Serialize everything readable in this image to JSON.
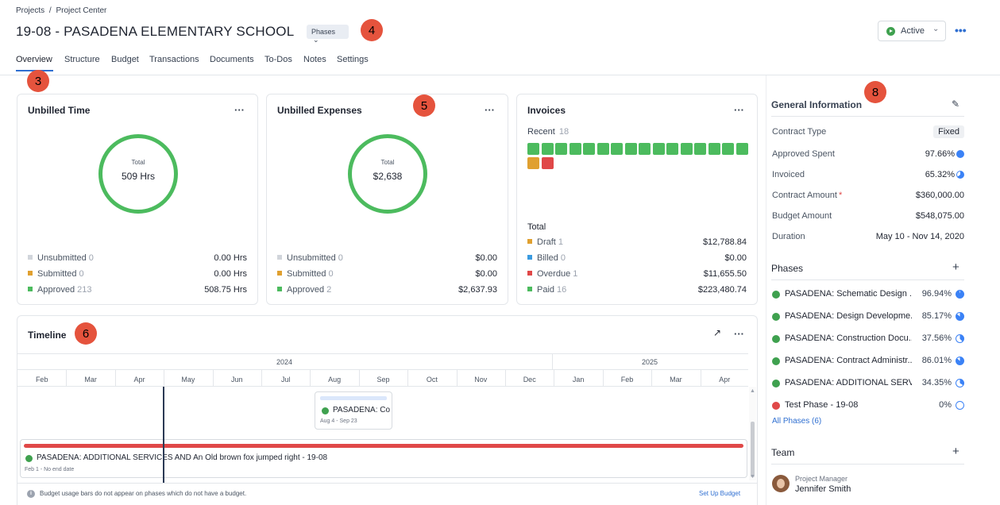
{
  "breadcrumb": {
    "projects": "Projects",
    "sep": "/",
    "current": "Project Center"
  },
  "project": {
    "title": "19-08 - PASADENA ELEMENTARY SCHOOL",
    "phases_btn": "Phases"
  },
  "status": {
    "label": "Active"
  },
  "tabs": [
    "Overview",
    "Structure",
    "Budget",
    "Transactions",
    "Documents",
    "To-Dos",
    "Notes",
    "Settings"
  ],
  "annotations": [
    "4",
    "3",
    "5",
    "6",
    "8"
  ],
  "unbilled_time": {
    "title": "Unbilled Time",
    "total_label": "Total",
    "total_value": "509 Hrs",
    "rows": [
      {
        "label": "Unsubmitted",
        "count": "0",
        "value": "0.00 Hrs",
        "color": "#d1d5db"
      },
      {
        "label": "Submitted",
        "count": "0",
        "value": "0.00 Hrs",
        "color": "#e0a030"
      },
      {
        "label": "Approved",
        "count": "213",
        "value": "508.75 Hrs",
        "color": "#4cbb5e"
      }
    ]
  },
  "unbilled_expenses": {
    "title": "Unbilled Expenses",
    "total_label": "Total",
    "total_value": "$2,638",
    "rows": [
      {
        "label": "Unsubmitted",
        "count": "0",
        "value": "$0.00",
        "color": "#d1d5db"
      },
      {
        "label": "Submitted",
        "count": "0",
        "value": "$0.00",
        "color": "#e0a030"
      },
      {
        "label": "Approved",
        "count": "2",
        "value": "$2,637.93",
        "color": "#4cbb5e"
      }
    ]
  },
  "invoices": {
    "title": "Invoices",
    "recent_label": "Recent",
    "recent_count": "18",
    "total_label": "Total",
    "green_count": 16,
    "rows": [
      {
        "label": "Draft",
        "count": "1",
        "value": "$12,788.84",
        "color": "#e0a030"
      },
      {
        "label": "Billed",
        "count": "0",
        "value": "$0.00",
        "color": "#3b9be0"
      },
      {
        "label": "Overdue",
        "count": "1",
        "value": "$11,655.50",
        "color": "#e04848"
      },
      {
        "label": "Paid",
        "count": "16",
        "value": "$223,480.74",
        "color": "#4cbb5e"
      }
    ]
  },
  "timeline": {
    "title": "Timeline",
    "years": [
      "2024",
      "2025"
    ],
    "months": [
      "Feb",
      "Mar",
      "Apr",
      "May",
      "Jun",
      "Jul",
      "Aug",
      "Sep",
      "Oct",
      "Nov",
      "Dec",
      "Jan",
      "Feb",
      "Mar",
      "Apr"
    ],
    "phase_card": {
      "name": "PASADENA: Co",
      "dates": "Aug 4 - Sep 23"
    },
    "bar": {
      "name": "PASADENA: ADDITIONAL SERVICES AND An Old brown fox jumped right - 19-08",
      "dates": "Feb 1 - No end date"
    },
    "footer_note": "Budget usage bars do not appear on phases which do not have a budget.",
    "setup_link": "Set Up Budget"
  },
  "general_info": {
    "title": "General Information",
    "rows": [
      {
        "label": "Contract Type",
        "value": "Fixed"
      },
      {
        "label": "Approved Spent",
        "value": "97.66%"
      },
      {
        "label": "Invoiced",
        "value": "65.32%"
      },
      {
        "label": "Contract Amount",
        "value": "$360,000.00",
        "required": "*"
      },
      {
        "label": "Budget Amount",
        "value": "$548,075.00"
      },
      {
        "label": "Duration",
        "value": "May 10 - Nov 14, 2020"
      }
    ]
  },
  "phases": {
    "title": "Phases",
    "add": "+",
    "items": [
      {
        "name": "PASADENA: Schematic Design ...",
        "pct": "96.94%",
        "state": "active"
      },
      {
        "name": "PASADENA: Design Developme...",
        "pct": "85.17%",
        "state": "active"
      },
      {
        "name": "PASADENA: Construction Docu...",
        "pct": "37.56%",
        "state": "active"
      },
      {
        "name": "PASADENA: Contract Administr...",
        "pct": "86.01%",
        "state": "active"
      },
      {
        "name": "PASADENA: ADDITIONAL SERV...",
        "pct": "34.35%",
        "state": "active"
      },
      {
        "name": "Test Phase - 19-08",
        "pct": "0%",
        "state": "stopped"
      }
    ],
    "all_link": "All Phases (6)"
  },
  "team": {
    "title": "Team",
    "add": "+",
    "role": "Project Manager",
    "name": "Jennifer Smith"
  },
  "colors": {
    "green": "#4cbb5e",
    "orange": "#e0a030",
    "red": "#e04848",
    "blue": "#3b82f6",
    "link": "#2f6fd1"
  }
}
